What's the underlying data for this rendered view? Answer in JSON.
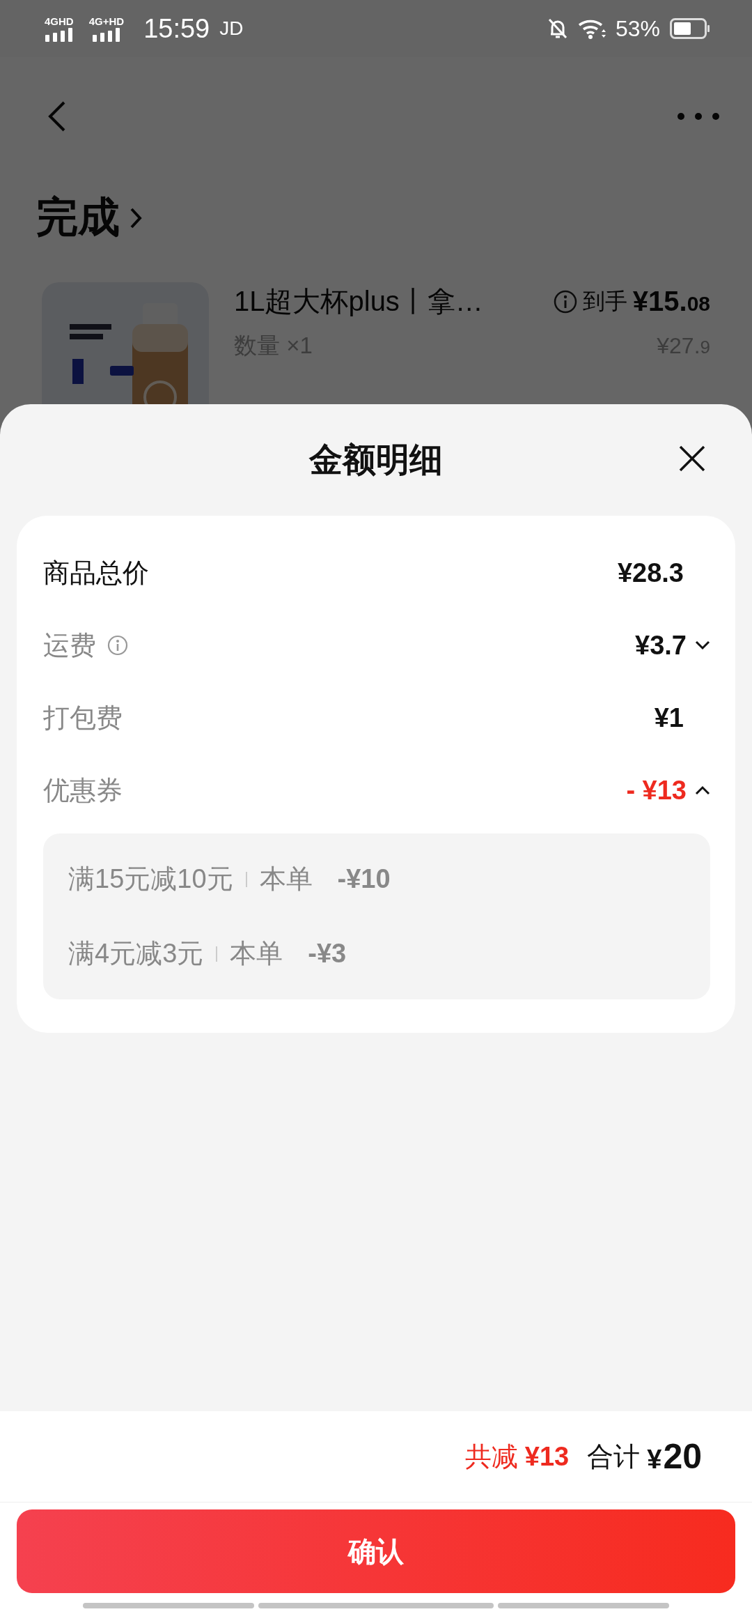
{
  "status_bar": {
    "networks": [
      "4GHD",
      "4G+HD"
    ],
    "time": "15:59",
    "carrier": "JD",
    "battery": "53%"
  },
  "page": {
    "title": "完成",
    "product": {
      "name": "1L超大杯plus丨拿…",
      "price_label": "到手",
      "price_main": "¥15.",
      "price_decimal": "08",
      "quantity": "数量 ×1",
      "original_main": "¥27.",
      "original_decimal": "9"
    }
  },
  "sheet": {
    "title": "金额明细",
    "rows": [
      {
        "label": "商品总价",
        "value": "¥28.3",
        "kind": "subtotal"
      },
      {
        "label": "运费",
        "value": "¥3.7",
        "kind": "toggle",
        "info": true,
        "expanded": false
      },
      {
        "label": "打包费",
        "value": "¥1",
        "kind": "plain"
      },
      {
        "label": "优惠券",
        "value": "- ¥13",
        "kind": "discount",
        "expanded": true
      }
    ],
    "coupons": [
      {
        "rule": "满15元减10元",
        "scope": "本单",
        "amount": "-¥10"
      },
      {
        "rule": "满4元减3元",
        "scope": "本单",
        "amount": "-¥3"
      }
    ]
  },
  "footer": {
    "discount_label": "共减",
    "discount": "¥13",
    "total_label": "合计",
    "total_currency": "¥",
    "total": "20",
    "confirm": "确认"
  }
}
